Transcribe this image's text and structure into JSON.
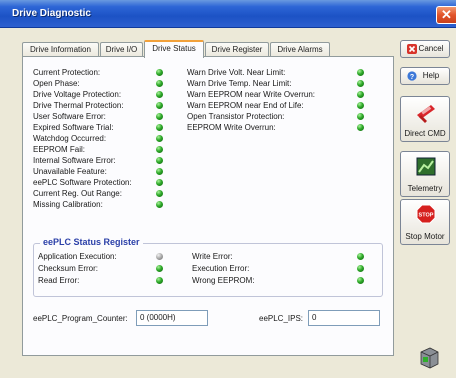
{
  "window": {
    "title": "Drive Diagnostic",
    "close_glyph": "✕"
  },
  "tabs": [
    {
      "label": "Drive Information",
      "active": false
    },
    {
      "label": "Drive I/O",
      "active": false
    },
    {
      "label": "Drive Status",
      "active": true
    },
    {
      "label": "Drive Register",
      "active": false
    },
    {
      "label": "Drive Alarms",
      "active": false
    }
  ],
  "status_left": [
    {
      "label": "Current Protection:",
      "state": "green"
    },
    {
      "label": "Open Phase:",
      "state": "green"
    },
    {
      "label": "Drive Voltage Protection:",
      "state": "green"
    },
    {
      "label": "Drive Thermal Protection:",
      "state": "green"
    },
    {
      "label": "User Software Error:",
      "state": "green"
    },
    {
      "label": "Expired Software Trial:",
      "state": "green"
    },
    {
      "label": "Watchdog Occurred:",
      "state": "green"
    },
    {
      "label": "EEPROM Fail:",
      "state": "green"
    },
    {
      "label": "Internal Software Error:",
      "state": "green"
    },
    {
      "label": "Unavailable Feature:",
      "state": "green"
    },
    {
      "label": "eePLC Software Protection:",
      "state": "green"
    },
    {
      "label": "Current Reg. Out Range:",
      "state": "green"
    },
    {
      "label": "Missing Calibration:",
      "state": "green"
    }
  ],
  "status_right": [
    {
      "label": "Warn Drive Volt. Near Limit:",
      "state": "green"
    },
    {
      "label": "Warn Drive Temp. Near Limit:",
      "state": "green"
    },
    {
      "label": "Warn EEPROM near Write Overrun:",
      "state": "green"
    },
    {
      "label": "Warn EEPROM near End of Life:",
      "state": "green"
    },
    {
      "label": "Open Transistor Protection:",
      "state": "green"
    },
    {
      "label": "EEPROM Write Overrun:",
      "state": "green"
    }
  ],
  "eeplc_register": {
    "title": "eePLC Status Register",
    "left": [
      {
        "label": "Application Execution:",
        "state": "grey"
      },
      {
        "label": "Checksum Error:",
        "state": "green"
      },
      {
        "label": "Read Error:",
        "state": "green"
      }
    ],
    "right": [
      {
        "label": "Write Error:",
        "state": "green"
      },
      {
        "label": "Execution Error:",
        "state": "green"
      },
      {
        "label": "Wrong EEPROM:",
        "state": "green"
      }
    ]
  },
  "fields": {
    "program_counter_label": "eePLC_Program_Counter:",
    "program_counter_value": "0 (0000H)",
    "ips_label": "eePLC_IPS:",
    "ips_value": "0"
  },
  "side_buttons": {
    "cancel": "Cancel",
    "help": "Help",
    "direct_cmd": "Direct CMD",
    "telemetry": "Telemetry",
    "stop_motor": "Stop Motor",
    "stop_sign_text": "STOP"
  },
  "colors": {
    "led_green": "#2faa2a",
    "led_grey": "#a8a8a8",
    "group_title": "#2a3fa8",
    "titlebar": "#1c52c5"
  }
}
